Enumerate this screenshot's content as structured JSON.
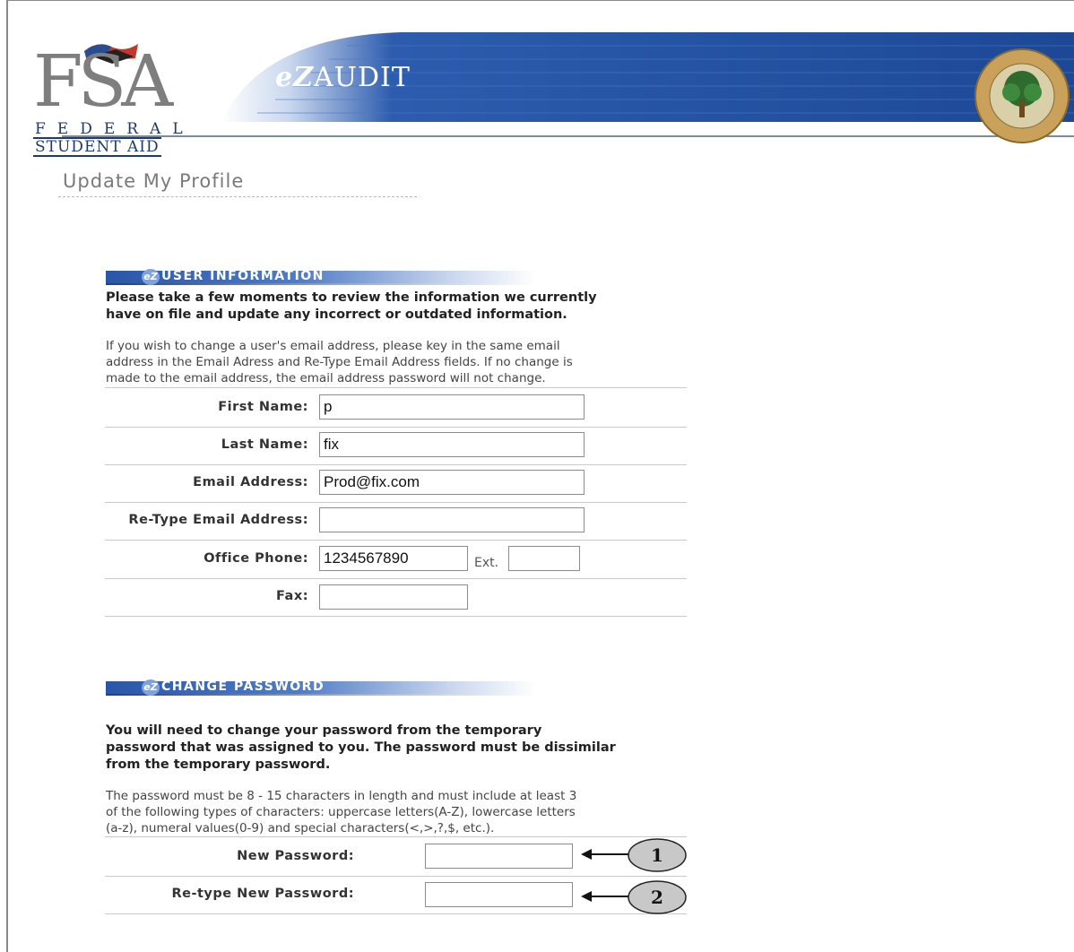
{
  "header": {
    "logo_letters": "FSA",
    "logo_federal": "FEDERAL",
    "logo_student": "STUDENT AID",
    "app_prefix": "eZ",
    "app_name": "AUDIT",
    "seal_text_top": "DEPARTMENT OF EDUCATION",
    "seal_text_bottom": "UNITED STATES OF AMERICA",
    "banner_color": "#1d4a9c"
  },
  "page_title": "Update My Profile",
  "user_info": {
    "section_label": "USER INFORMATION",
    "intro_bold": [
      "Please take a few moments to review the information we currently",
      "have on file and update any incorrect or outdated information."
    ],
    "intro_text": [
      "If you wish to change a user's email address, please key in the same email",
      "address in the Email Adress and Re-Type Email Address fields. If no change is",
      "made to the email address, the email address password will not change."
    ],
    "fields": {
      "first_name": {
        "label": "First Name:",
        "value": "p"
      },
      "last_name": {
        "label": "Last Name:",
        "value": "fix"
      },
      "email": {
        "label": "Email Address:",
        "value": "Prod@fix.com"
      },
      "retype_email": {
        "label": "Re-Type Email Address:",
        "value": ""
      },
      "office_phone": {
        "label": "Office Phone:",
        "value": "1234567890",
        "ext_label": "Ext.",
        "ext_value": ""
      },
      "fax": {
        "label": "Fax:",
        "value": ""
      }
    }
  },
  "change_password": {
    "section_label": "CHANGE PASSWORD",
    "intro_bold": [
      "You will need to change your password from the temporary",
      "password that was assigned to you. The password must be dissimilar",
      "from the temporary password."
    ],
    "intro_text": [
      "The password must be 8 - 15 characters in length and must include at least 3",
      "of the following types of characters: uppercase letters(A-Z), lowercase letters",
      "(a-z), numeral values(0-9) and special characters(<,>,?,$, etc.)."
    ],
    "fields": {
      "new_password": {
        "label": "New Password:",
        "value": ""
      },
      "retype_password": {
        "label": "Re-type New Password:",
        "value": ""
      }
    }
  },
  "callouts": [
    "1",
    "2"
  ]
}
